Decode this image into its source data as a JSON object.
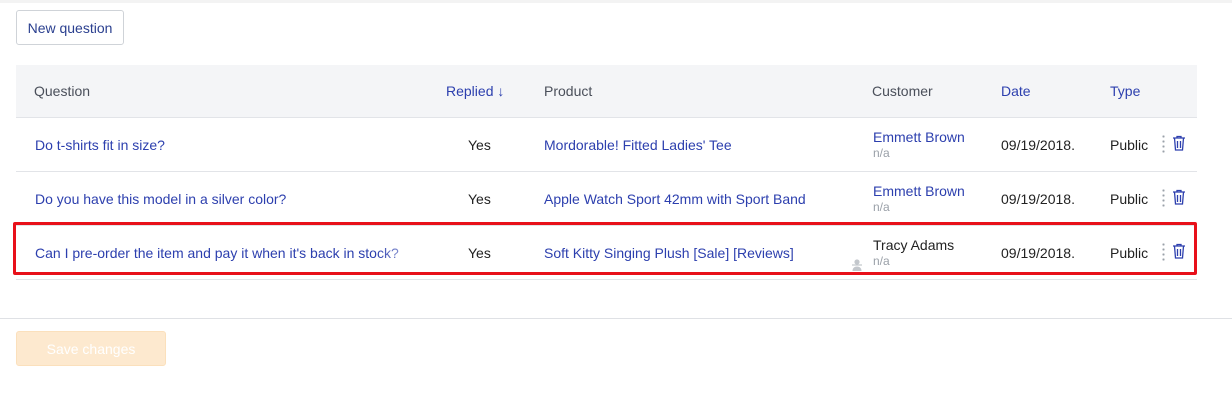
{
  "toolbar": {
    "new_question_label": "New question"
  },
  "table": {
    "columns": {
      "question": "Question",
      "replied": "Replied ↓",
      "product": "Product",
      "customer": "Customer",
      "date": "Date",
      "type": "Type"
    },
    "rows": [
      {
        "question": "Do t-shirts fit in size?",
        "replied": "Yes",
        "product": "Mordorable! Fitted Ladies' Tee",
        "customer": "Emmett Brown",
        "customer_sub": "n/a",
        "date": "09/19/2018.",
        "type": "Public"
      },
      {
        "question": "Do you have this model in a silver color?",
        "replied": "Yes",
        "product": "Apple Watch Sport 42mm with Sport Band",
        "customer": "Emmett Brown",
        "customer_sub": "n/a",
        "date": "09/19/2018.",
        "type": "Public"
      },
      {
        "question": "Can I pre-order the item and pay it when it's back in stock?",
        "replied": "Yes",
        "product": "Soft Kitty Singing Plush [Sale] [Reviews]",
        "customer": "Tracy Adams",
        "customer_sub": "n/a",
        "date": "09/19/2018.",
        "type": "Public"
      }
    ]
  },
  "footer": {
    "save_label": "Save changes"
  },
  "colors": {
    "link": "#2c3fae",
    "highlight": "#e8101a",
    "save_disabled": "#fde9cf"
  }
}
